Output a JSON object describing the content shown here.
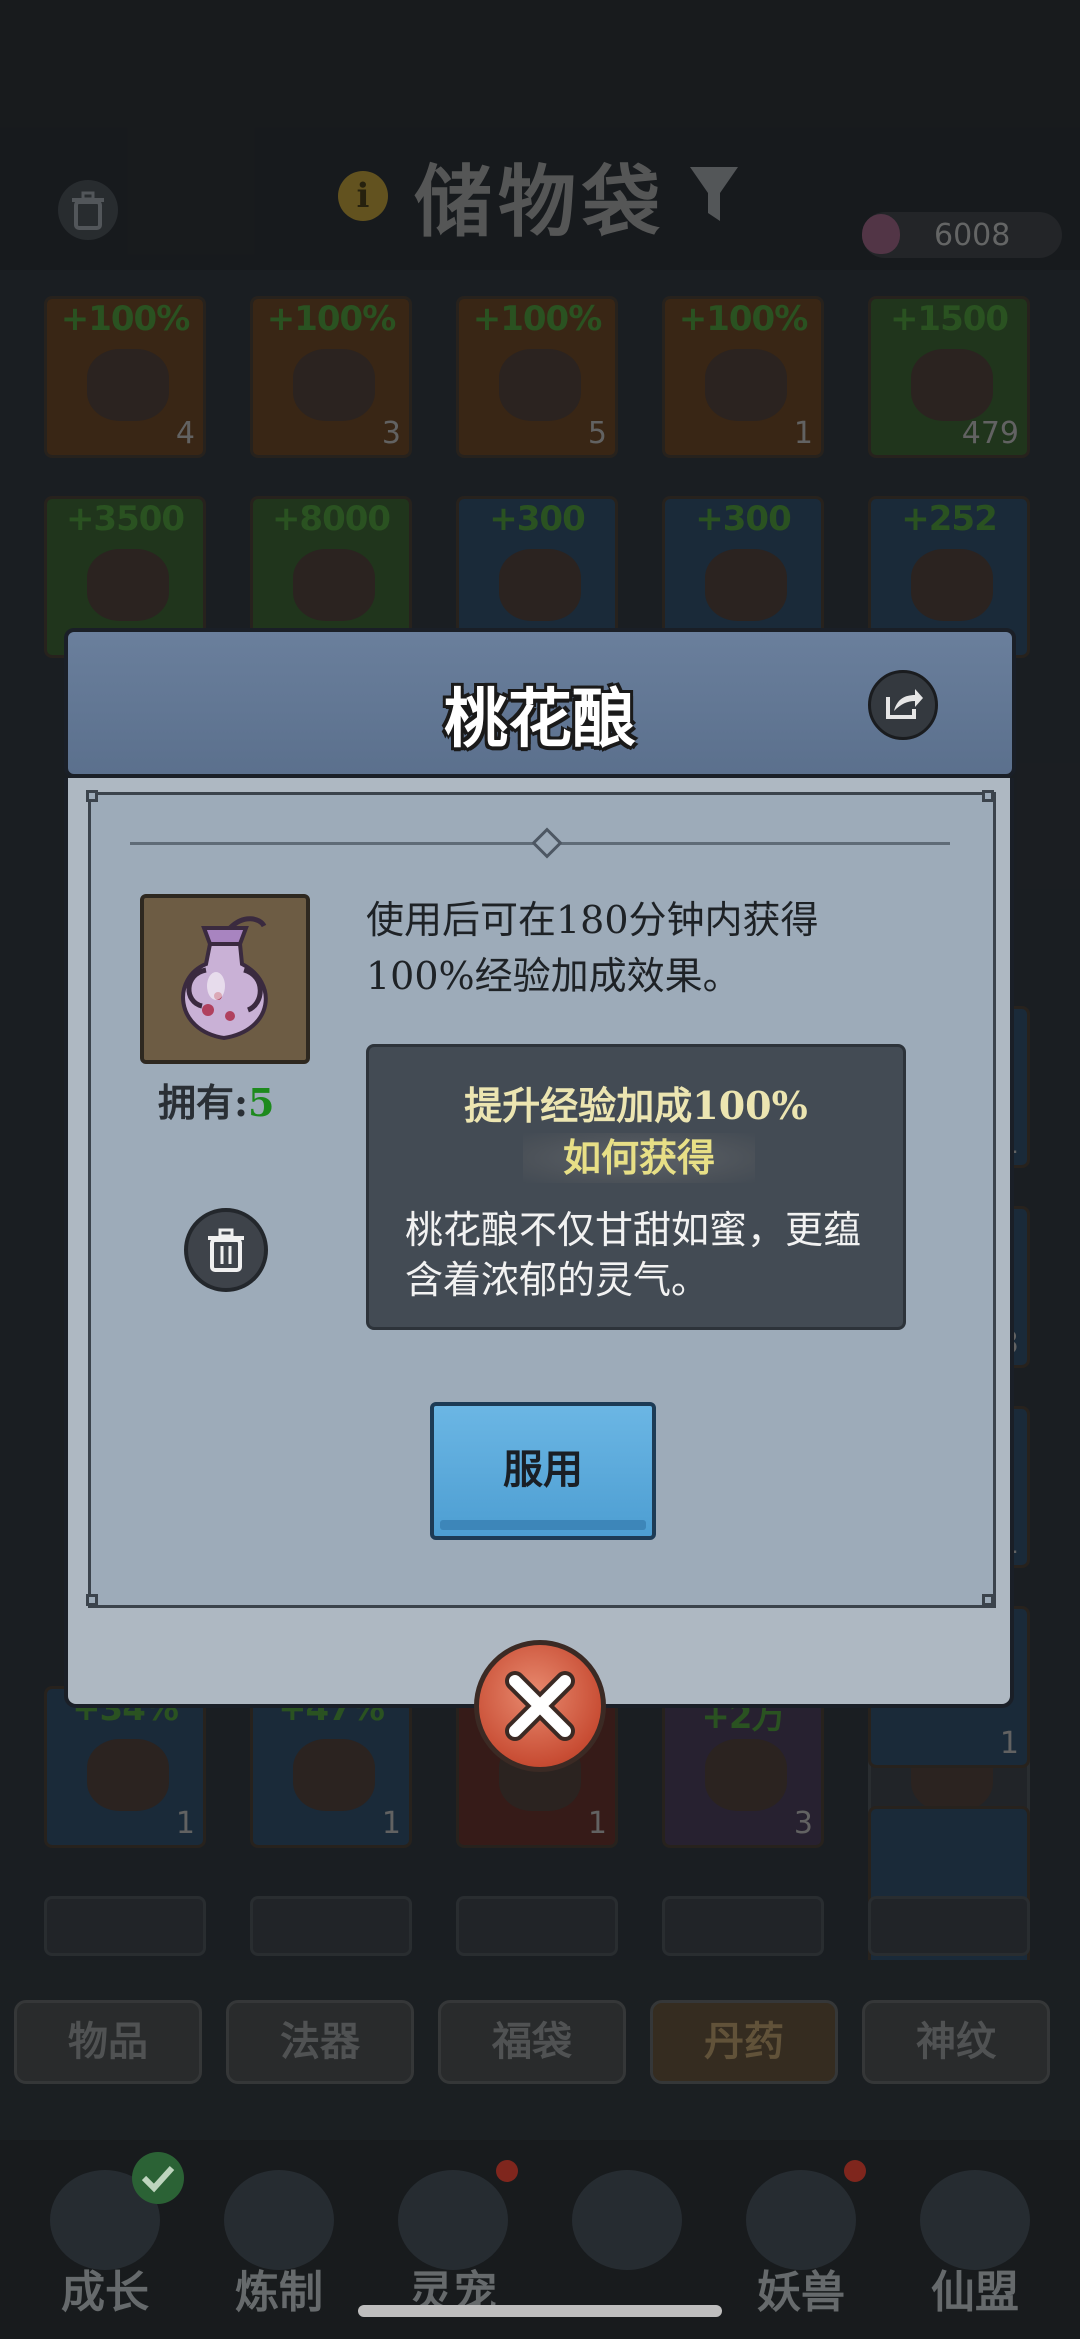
{
  "background": {
    "title": "储物袋",
    "currency_amount": "6008",
    "grid_rows": [
      [
        {
          "bonus": "+100%",
          "count": "4",
          "tone": "orange"
        },
        {
          "bonus": "+100%",
          "count": "3",
          "tone": "orange"
        },
        {
          "bonus": "+100%",
          "count": "5",
          "tone": "orange"
        },
        {
          "bonus": "+100%",
          "count": "1",
          "tone": "orange"
        },
        {
          "bonus": "+1500",
          "count": "479",
          "tone": "green"
        }
      ],
      [
        {
          "bonus": "+3500",
          "count": "",
          "tone": "green"
        },
        {
          "bonus": "+8000",
          "count": "",
          "tone": "green"
        },
        {
          "bonus": "+300",
          "count": "",
          "tone": "blue"
        },
        {
          "bonus": "+300",
          "count": "",
          "tone": "blue"
        },
        {
          "bonus": "+252",
          "count": "",
          "tone": "blue"
        }
      ],
      [
        {
          "bonus": "+34%",
          "count": "1",
          "tone": "blue"
        },
        {
          "bonus": "+47%",
          "count": "1",
          "tone": "blue"
        },
        {
          "bonus": "",
          "count": "1",
          "tone": "red"
        },
        {
          "bonus": "+2万",
          "count": "3",
          "tone": "purple"
        },
        {
          "bonus": "",
          "count": "",
          "tone": "empty"
        }
      ]
    ],
    "side_counts": [
      "1",
      "3",
      "1",
      "1",
      "1"
    ],
    "categories": [
      {
        "label": "物品",
        "active": false
      },
      {
        "label": "法器",
        "active": false
      },
      {
        "label": "福袋",
        "active": false
      },
      {
        "label": "丹药",
        "active": true
      },
      {
        "label": "神纹",
        "active": false
      }
    ],
    "nav": [
      {
        "label": "成长"
      },
      {
        "label": "炼制"
      },
      {
        "label": "灵宠"
      },
      {
        "label": ""
      },
      {
        "label": "妖兽"
      },
      {
        "label": "仙盟"
      }
    ]
  },
  "modal": {
    "title": "桃花酿",
    "owned_label": "拥有:",
    "owned_count": "5",
    "description": "使用后可在180分钟内获得100%经验加成效果。",
    "effect": "提升经验加成100%",
    "howto_title": "如何获得",
    "lore": "桃花酿不仅甘甜如蜜，更蕴含着浓郁的灵气。",
    "use_button": "服用"
  },
  "colors": {
    "header_blue": "#5f7492",
    "panel_gray": "#9dabb9",
    "use_button_blue": "#5aa8db",
    "close_button_red": "#c84d34",
    "owned_green": "#1d8a1d",
    "effect_yellow": "#ece5b1"
  },
  "icons": [
    "trash-icon",
    "info-icon",
    "filter-icon",
    "gem-icon",
    "share-icon",
    "close-icon",
    "check-icon"
  ]
}
